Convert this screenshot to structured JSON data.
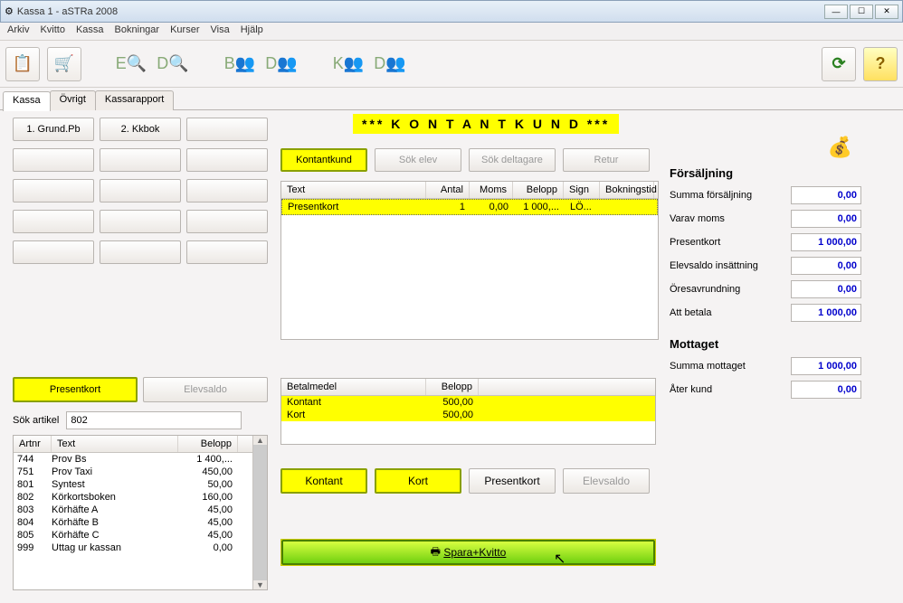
{
  "window": {
    "title": "Kassa 1 - aSTRa 2008"
  },
  "menu": [
    "Arkiv",
    "Kvitto",
    "Kassa",
    "Bokningar",
    "Kurser",
    "Visa",
    "Hjälp"
  ],
  "tabs": [
    "Kassa",
    "Övrigt",
    "Kassarapport"
  ],
  "top_buttons": [
    "1. Grund.Pb",
    "2. Kkbok"
  ],
  "banner": "*** K O N T A N T K U N D ***",
  "search_buttons": {
    "kontantkund": "Kontantkund",
    "sokelev": "Sök elev",
    "sokdeltagare": "Sök deltagare",
    "retur": "Retur"
  },
  "cart": {
    "headers": {
      "text": "Text",
      "antal": "Antal",
      "moms": "Moms",
      "belopp": "Belopp",
      "sign": "Sign",
      "bokningstid": "Bokningstid"
    },
    "rows": [
      {
        "text": "Presentkort",
        "antal": "1",
        "moms": "0,00",
        "belopp": "1 000,...",
        "sign": "LÖ...",
        "bokningstid": ""
      }
    ]
  },
  "big_buttons": {
    "presentkort": "Presentkort",
    "elevsaldo": "Elevsaldo"
  },
  "sok_artikel": {
    "label": "Sök artikel",
    "value": "802"
  },
  "articles": {
    "headers": {
      "artnr": "Artnr",
      "text": "Text",
      "belopp": "Belopp"
    },
    "rows": [
      {
        "artnr": "744",
        "text": "Prov Bs",
        "belopp": "1 400,..."
      },
      {
        "artnr": "751",
        "text": "Prov Taxi",
        "belopp": "450,00"
      },
      {
        "artnr": "801",
        "text": "Syntest",
        "belopp": "50,00"
      },
      {
        "artnr": "802",
        "text": "Körkortsboken",
        "belopp": "160,00"
      },
      {
        "artnr": "803",
        "text": "Körhäfte A",
        "belopp": "45,00"
      },
      {
        "artnr": "804",
        "text": "Körhäfte B",
        "belopp": "45,00"
      },
      {
        "artnr": "805",
        "text": "Körhäfte C",
        "belopp": "45,00"
      },
      {
        "artnr": "999",
        "text": "Uttag ur kassan",
        "belopp": "0,00"
      }
    ]
  },
  "payments": {
    "headers": {
      "medel": "Betalmedel",
      "belopp": "Belopp"
    },
    "rows": [
      {
        "medel": "Kontant",
        "belopp": "500,00"
      },
      {
        "medel": "Kort",
        "belopp": "500,00"
      }
    ]
  },
  "pay_buttons": {
    "kontant": "Kontant",
    "kort": "Kort",
    "presentkort": "Presentkort",
    "elevsaldo": "Elevsaldo"
  },
  "sales": {
    "title": "Försäljning",
    "rows": [
      {
        "label": "Summa försäljning",
        "val": "0,00"
      },
      {
        "label": "Varav moms",
        "val": "0,00"
      },
      {
        "label": "Presentkort",
        "val": "1 000,00"
      },
      {
        "label": "Elevsaldo insättning",
        "val": "0,00"
      },
      {
        "label": "Öresavrundning",
        "val": "0,00"
      },
      {
        "label": "Att betala",
        "val": "1 000,00"
      }
    ]
  },
  "received": {
    "title": "Mottaget",
    "rows": [
      {
        "label": "Summa mottaget",
        "val": "1 000,00"
      },
      {
        "label": "Åter kund",
        "val": "0,00"
      }
    ]
  },
  "save_button": "Spara+Kvitto"
}
